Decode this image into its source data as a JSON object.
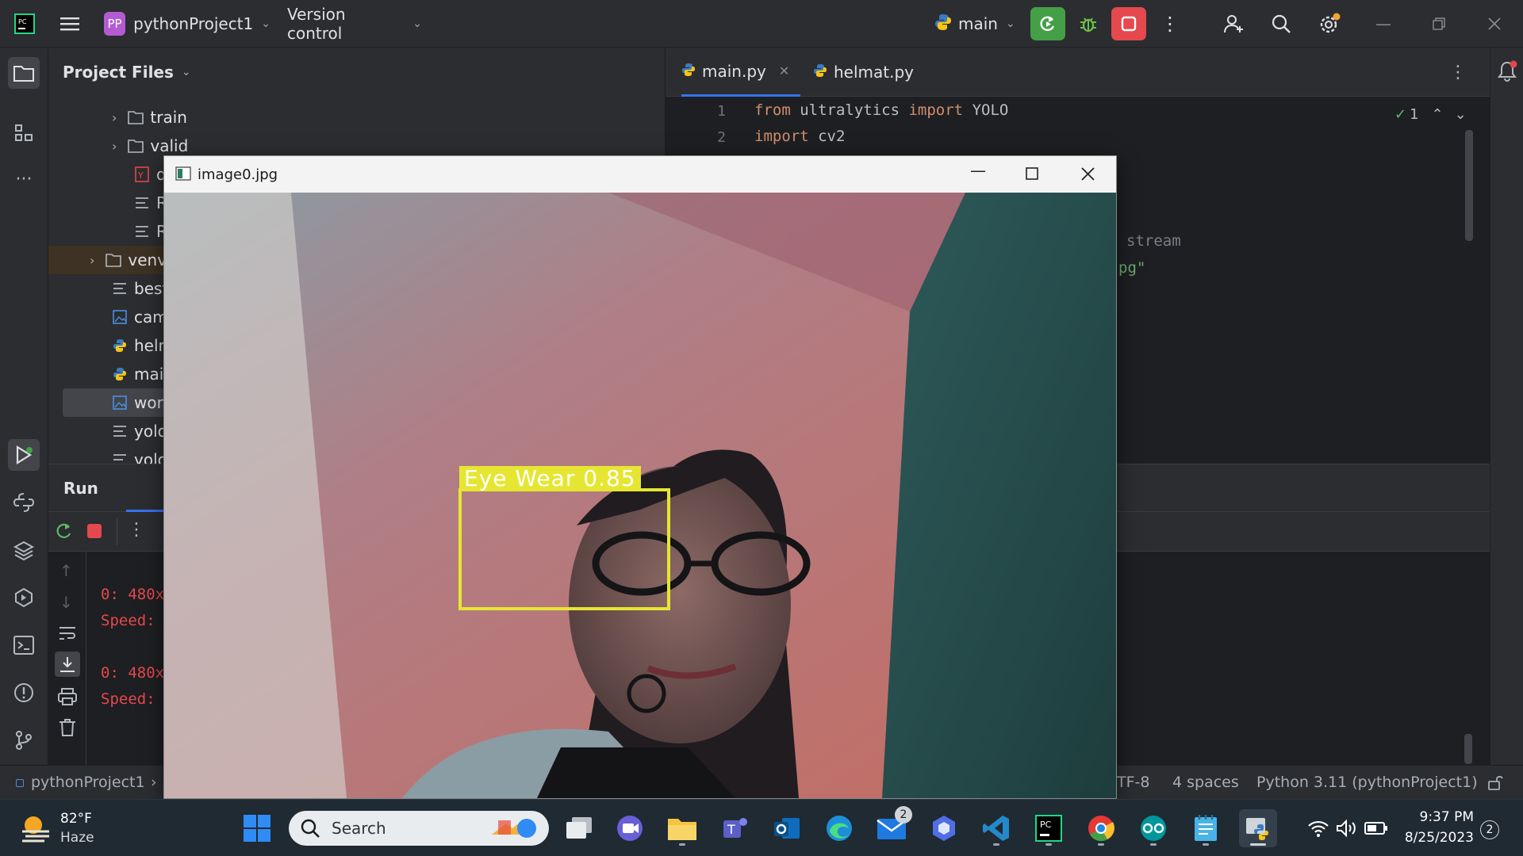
{
  "titlebar": {
    "app_icon": "pycharm-logo",
    "project_badge": "PP",
    "project_name": "pythonProject1",
    "vcs_menu": "Version control",
    "branch": "main",
    "colors": {
      "badge": "#b45bd4",
      "run_green": "#43a047",
      "stop_red": "#e5484d"
    }
  },
  "left_strip": {
    "icons": [
      "folder-icon",
      "structure-icon",
      "more-icon",
      "run-icon",
      "python-console-icon",
      "layers-icon",
      "services-icon",
      "terminal-icon",
      "problems-icon",
      "git-icon"
    ]
  },
  "project": {
    "title": "Project Files",
    "rows": [
      {
        "label": "train",
        "kind": "folder"
      },
      {
        "label": "valid",
        "kind": "folder"
      },
      {
        "label": "d",
        "kind": "yaml"
      },
      {
        "label": "R",
        "kind": "text"
      },
      {
        "label": "R",
        "kind": "text"
      },
      {
        "label": "venv",
        "kind": "folder"
      },
      {
        "label": "best",
        "kind": "text"
      },
      {
        "label": "cam",
        "kind": "image"
      },
      {
        "label": "helm",
        "kind": "python"
      },
      {
        "label": "main",
        "kind": "python"
      },
      {
        "label": "wor",
        "kind": "image"
      },
      {
        "label": "yolo",
        "kind": "text"
      },
      {
        "label": "yolo",
        "kind": "text"
      }
    ]
  },
  "editor": {
    "tabs": [
      {
        "label": "main.py"
      },
      {
        "label": "helmat.py"
      }
    ],
    "inspection_count": "1",
    "lines": [
      {
        "num": "1",
        "parts": [
          {
            "t": "from",
            "c": "kw"
          },
          {
            "t": " ultralytics ",
            "c": ""
          },
          {
            "t": "import",
            "c": "kw"
          },
          {
            "t": " YOLO",
            "c": ""
          }
        ]
      },
      {
        "num": "2",
        "parts": [
          {
            "t": "import",
            "c": "kw"
          },
          {
            "t": " cv2",
            "c": ""
          }
        ]
      }
    ],
    "partial_code_1": "stream",
    "partial_code_2": "pg\""
  },
  "run": {
    "tab_label": "Run",
    "config_label": "m",
    "console_lines": [
      "0: 480x",
      "Speed:",
      "0: 480x",
      "Speed:"
    ]
  },
  "status": {
    "project": "pythonProject1",
    "encoding": "TF-8",
    "indent": "4 spaces",
    "interpreter": "Python 3.11 (pythonProject1)"
  },
  "image_window": {
    "title": "image0.jpg",
    "detection_label": "Eye Wear 0.85",
    "detection_color": "#e6e632"
  },
  "taskbar": {
    "weather_temp": "82°F",
    "weather_desc": "Haze",
    "search_label": "Search",
    "mail_badge": "2",
    "time": "9:37 PM",
    "date": "8/25/2023",
    "notification_count": "2"
  }
}
